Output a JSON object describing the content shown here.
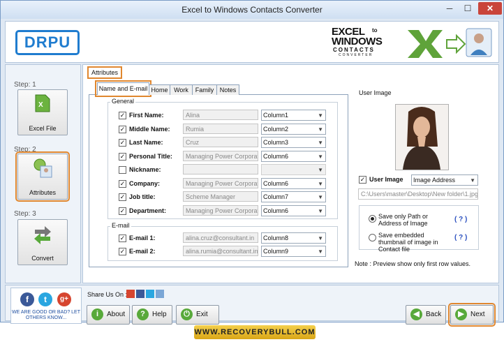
{
  "window": {
    "title": "Excel to Windows Contacts Converter",
    "minimize": "─",
    "maximize": "☐",
    "close": "✕"
  },
  "header": {
    "logo": "DRPU",
    "product_logo_lines": [
      "EXCEL",
      "WINDOWS",
      "CONTACTS",
      "CONVERTER"
    ],
    "product_logo_to": "to"
  },
  "steps": [
    {
      "step": "Step: 1",
      "label": "Excel File"
    },
    {
      "step": "Step: 2",
      "label": "Attributes"
    },
    {
      "step": "Step: 3",
      "label": "Convert"
    }
  ],
  "main": {
    "section_title": "Attributes",
    "tabs": [
      "Name and E-mail",
      "Home",
      "Work",
      "Family",
      "Notes"
    ],
    "general_label": "General",
    "general_fields": [
      {
        "label": "First Name:",
        "checked": true,
        "value": "Alina",
        "column": "Column1"
      },
      {
        "label": "Middle Name:",
        "checked": true,
        "value": "Rumia",
        "column": "Column2"
      },
      {
        "label": "Last Name:",
        "checked": true,
        "value": "Cruz",
        "column": "Column3"
      },
      {
        "label": "Personal Title:",
        "checked": true,
        "value": "Managing Power Corporation",
        "column": "Column6"
      },
      {
        "label": "Nickname:",
        "checked": false,
        "value": "",
        "column": ""
      },
      {
        "label": "Company:",
        "checked": true,
        "value": "Managing Power Corporation",
        "column": "Column6"
      },
      {
        "label": "Job title:",
        "checked": true,
        "value": "Scheme Manager",
        "column": "Column7"
      },
      {
        "label": "Department:",
        "checked": true,
        "value": "Managing Power Corporation",
        "column": "Column6"
      }
    ],
    "email_label": "E-mail",
    "email_fields": [
      {
        "label": "E-mail 1:",
        "checked": true,
        "value": "alina.cruz@consultant.in",
        "column": "Column8"
      },
      {
        "label": "E-mail 2:",
        "checked": true,
        "value": "alina.rumia@consultant.in",
        "column": "Column9"
      }
    ],
    "user_image": {
      "group_label": "User Image",
      "checkbox_label": "User Image",
      "mode": "Image Address",
      "path": "C:\\Users\\master\\Desktop\\New folder\\1.jpg",
      "option1": "Save only Path or Address of Image",
      "option2": "Save embedded thumbnail of image in Contact file",
      "help": "( ? )",
      "note": "Note : Preview show only first row values."
    }
  },
  "bottom": {
    "share_label": "Share Us On :",
    "social_text": "WE ARE GOOD OR BAD? LET OTHERS KNOW...",
    "buttons": {
      "about": "About",
      "help": "Help",
      "exit": "Exit",
      "back": "Back",
      "next": "Next"
    },
    "banner": "WWW.RECOVERYBULL.COM"
  },
  "colors": {
    "accent": "#1f7ccf",
    "highlight": "#e0872f",
    "green": "#58a93a",
    "banner": "#e8b62a"
  }
}
